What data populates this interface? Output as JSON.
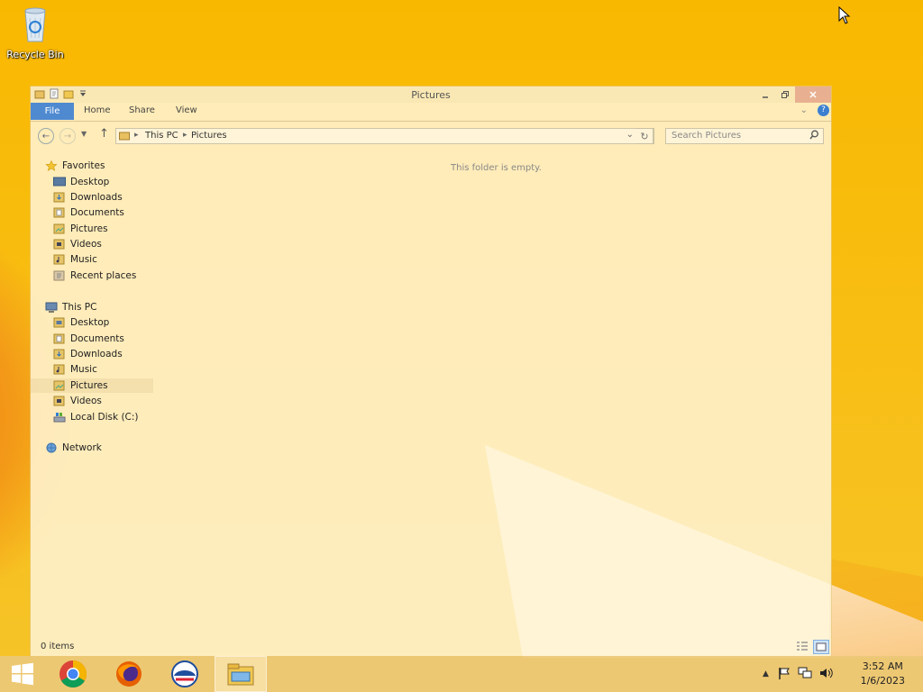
{
  "desktop": {
    "icons": [
      {
        "label": "Recycle Bin",
        "icon": "recycle-bin-icon"
      }
    ]
  },
  "window": {
    "title": "Pictures",
    "ribbon": {
      "file_tab": "File",
      "tabs": [
        "Home",
        "Share",
        "View"
      ]
    },
    "address": {
      "crumbs": [
        "This PC",
        "Pictures"
      ]
    },
    "search": {
      "placeholder": "Search Pictures"
    },
    "nav": {
      "favorites": {
        "label": "Favorites",
        "items": [
          "Desktop",
          "Downloads",
          "Documents",
          "Pictures",
          "Videos",
          "Music",
          "Recent places"
        ]
      },
      "this_pc": {
        "label": "This PC",
        "items": [
          "Desktop",
          "Documents",
          "Downloads",
          "Music",
          "Pictures",
          "Videos",
          "Local Disk (C:)"
        ],
        "selected": "Pictures"
      },
      "network": {
        "label": "Network"
      }
    },
    "content": {
      "empty_message": "This folder is empty."
    },
    "status": {
      "item_count": "0 items"
    }
  },
  "taskbar": {
    "apps": [
      "start-button",
      "chrome-icon",
      "firefox-icon",
      "edge-icon",
      "file-explorer-icon"
    ],
    "active_app": "file-explorer-icon",
    "clock": {
      "time": "3:52 AM",
      "date": "1/6/2023"
    }
  },
  "colors": {
    "desktop_bg": "#f9b800",
    "file_tab": "#4f8ad1",
    "selection": "#ebd7a0"
  }
}
